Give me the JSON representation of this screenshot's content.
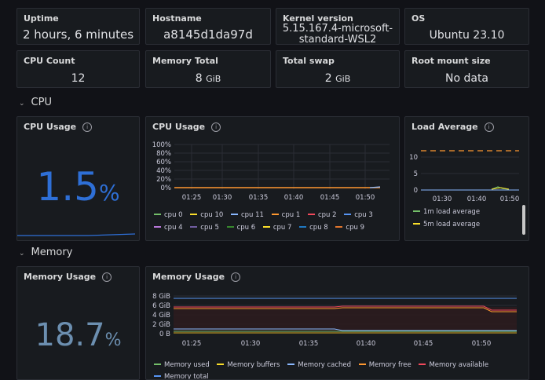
{
  "stats": {
    "uptime": {
      "title": "Uptime",
      "value": "2 hours, 6 minutes"
    },
    "hostname": {
      "title": "Hostname",
      "value": "a8145d1da97d"
    },
    "kernel": {
      "title": "Kernel version",
      "value_line1": "5.15.167.4-microsoft-",
      "value_line2": "standard-WSL2"
    },
    "os": {
      "title": "OS",
      "value": "Ubuntu 23.10"
    },
    "cpu_count": {
      "title": "CPU Count",
      "value": "12"
    },
    "memory_total": {
      "title": "Memory Total",
      "value": "8",
      "unit": "GiB"
    },
    "total_swap": {
      "title": "Total swap",
      "value": "2",
      "unit": "GiB"
    },
    "root_mount": {
      "title": "Root mount size",
      "value": "No data"
    }
  },
  "rows": {
    "cpu": {
      "title": "CPU"
    },
    "memory": {
      "title": "Memory"
    }
  },
  "cpu_usage_gauge": {
    "title": "CPU Usage",
    "value": "1.5",
    "unit": "%",
    "color": "#2e6fd6"
  },
  "cpu_usage_chart": {
    "title": "CPU Usage",
    "y_ticks": [
      "100%",
      "80%",
      "60%",
      "40%",
      "20%",
      "0%"
    ],
    "x_ticks": [
      "01:25",
      "01:30",
      "01:35",
      "01:40",
      "01:45",
      "01:50"
    ],
    "legend": [
      {
        "name": "cpu 0",
        "color": "#73bf69"
      },
      {
        "name": "cpu 10",
        "color": "#fade2a"
      },
      {
        "name": "cpu 11",
        "color": "#8ab8ff"
      },
      {
        "name": "cpu 1",
        "color": "#ff9830"
      },
      {
        "name": "cpu 2",
        "color": "#f2495c"
      },
      {
        "name": "cpu 3",
        "color": "#5794f2"
      },
      {
        "name": "cpu 4",
        "color": "#b877d9"
      },
      {
        "name": "cpu 5",
        "color": "#705da0"
      },
      {
        "name": "cpu 6",
        "color": "#37872d"
      },
      {
        "name": "cpu 7",
        "color": "#fade2a"
      },
      {
        "name": "cpu 8",
        "color": "#1f78c1"
      },
      {
        "name": "cpu 9",
        "color": "#e0752d"
      }
    ]
  },
  "load_average": {
    "title": "Load Average",
    "y_ticks": [
      "10",
      "5",
      "0"
    ],
    "x_ticks": [
      "01:30",
      "01:40",
      "01:50"
    ],
    "legend": [
      {
        "name": "1m load average",
        "color": "#73bf69"
      },
      {
        "name": "5m load average",
        "color": "#fade2a"
      }
    ]
  },
  "memory_gauge": {
    "title": "Memory Usage",
    "value": "18.7",
    "unit": "%",
    "color": "#6c8fb0"
  },
  "memory_chart": {
    "title": "Memory Usage",
    "y_ticks": [
      "8 GiB",
      "6 GiB",
      "4 GiB",
      "2 GiB",
      "0 B"
    ],
    "x_ticks": [
      "01:25",
      "01:30",
      "01:35",
      "01:40",
      "01:45",
      "01:50"
    ],
    "legend": [
      {
        "name": "Memory used",
        "color": "#73bf69"
      },
      {
        "name": "Memory buffers",
        "color": "#fade2a"
      },
      {
        "name": "Memory cached",
        "color": "#8ab8ff"
      },
      {
        "name": "Memory free",
        "color": "#ff9830"
      },
      {
        "name": "Memory available",
        "color": "#f2495c"
      },
      {
        "name": "Memory total",
        "color": "#5794f2"
      }
    ]
  }
}
